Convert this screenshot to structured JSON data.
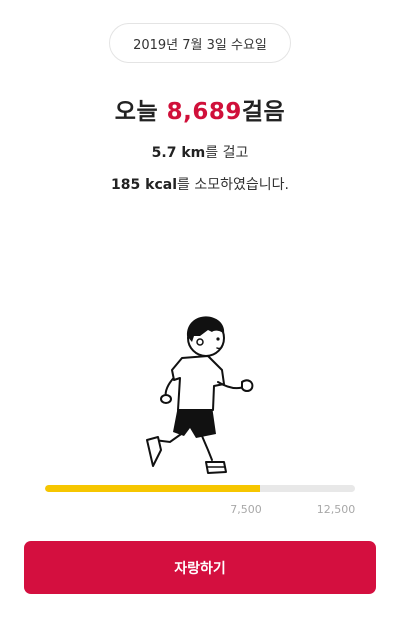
{
  "date": "2019년 7월 3일 수요일",
  "headline": {
    "prefix": "오늘 ",
    "steps": "8,689",
    "suffix": "걸음"
  },
  "distance": {
    "value": "5.7 km",
    "suffix": "를 걸고"
  },
  "calories": {
    "value": "185 kcal",
    "suffix": "를 소모하였습니다."
  },
  "progress": {
    "current_steps": 8689,
    "max_steps": 12500,
    "fill_color": "#f6c600",
    "track_color": "#e8e8e8",
    "ticks": [
      "7,500",
      "12,500"
    ]
  },
  "illustration": "running-boy-illustration",
  "colors": {
    "accent": "#d0103a",
    "button": "#d40f3f"
  },
  "share_button_label": "자랑하기"
}
